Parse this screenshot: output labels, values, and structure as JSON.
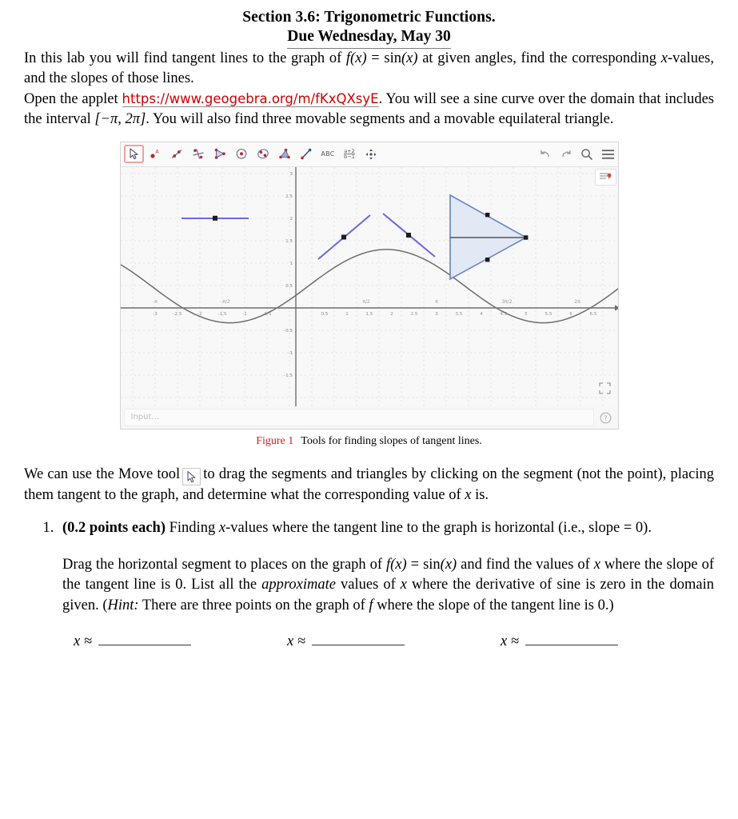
{
  "document": {
    "title_line1": "Section 3.6: Trigonometric Functions.",
    "title_line2": "Due Wednesday, May 30",
    "intro": {
      "part1": "In this lab you will find tangent lines to the graph of ",
      "formula": "f(x) = sin(x)",
      "part2": " at given angles, find the corresponding ",
      "xvar": "x",
      "part3": "-values, and the slopes of those lines."
    },
    "applet_paragraph": {
      "part1": "Open the applet ",
      "url": "https://www.geogebra.org/m/fKxQXsyE",
      "part2": ". You will see a sine curve over the domain that includes the interval ",
      "interval": "[−π, 2π]",
      "part3": ". You will also find three movable segments and a movable equilateral triangle."
    },
    "figure_caption": {
      "number": "Figure 1",
      "text": "Tools for finding slopes of tangent lines."
    },
    "move_paragraph": {
      "part1": "We can use the Move tool",
      "part2": "to drag the segments and triangles by clicking on the segment (not the point), placing them tangent to the graph, and determine what the corresponding value of ",
      "xvar": "x",
      "part3": " is."
    },
    "question1": {
      "number": "1.",
      "points": "(0.2 points each)",
      "prompt_part1": " Finding ",
      "xvar": "x",
      "prompt_part2": "-values where the tangent line to the graph is horizontal (i.e., slope = 0).",
      "subtext_part1": "Drag the horizontal segment to places on the graph of ",
      "formula": "f(x) = sin(x)",
      "subtext_part2": " and find the values of ",
      "subtext_part3": " where the slope of the tangent line is 0. List all the ",
      "emph": "approximate",
      "subtext_part4": " values of ",
      "subtext_part5": " where the derivative of sine is zero in the domain given. (",
      "hint_label": "Hint:",
      "subtext_part6": " There are three points on the graph of ",
      "fvar": "f",
      "subtext_part7": " where the slope of the tangent line is 0.)"
    },
    "answer_blanks": [
      {
        "label": "x ≈"
      },
      {
        "label": "x ≈"
      },
      {
        "label": "x ≈"
      }
    ]
  },
  "applet": {
    "toolbar": [
      {
        "name": "move-tool",
        "icon": "arrow-cursor",
        "selected": true
      },
      {
        "name": "point-tool",
        "icon": "point-a",
        "selected": false
      },
      {
        "name": "line-tool",
        "icon": "line-through-points",
        "selected": false
      },
      {
        "name": "perpendicular-line-tool",
        "icon": "perpendicular-lines",
        "selected": false
      },
      {
        "name": "polygon-tool",
        "icon": "triangle-polygon",
        "selected": false
      },
      {
        "name": "circle-tool",
        "icon": "circle-center-point",
        "selected": false
      },
      {
        "name": "conic-tool",
        "icon": "ellipse",
        "selected": false
      },
      {
        "name": "angle-tool",
        "icon": "angle-measure",
        "selected": false
      },
      {
        "name": "slope-tool",
        "icon": "slope-line",
        "selected": false
      },
      {
        "name": "text-tool",
        "icon": "abc-text",
        "selected": false
      },
      {
        "name": "slider-tool",
        "icon": "fraction-expression",
        "selected": false
      },
      {
        "name": "move-graphics-tool",
        "icon": "four-way-arrows",
        "selected": false
      }
    ],
    "right_tools": [
      {
        "name": "undo-button",
        "icon": "undo-arrow"
      },
      {
        "name": "redo-button",
        "icon": "redo-arrow"
      },
      {
        "name": "search-button",
        "icon": "magnifier-icon"
      },
      {
        "name": "menu-button",
        "icon": "hamburger-icon"
      }
    ],
    "style_button": "style-bar-icon",
    "fullscreen_button": "fullscreen-icon",
    "help_button": "question-mark-icon",
    "input_placeholder": "Input…"
  },
  "chart_data": {
    "type": "line",
    "title": "",
    "xlabel": "",
    "ylabel": "",
    "xlim": [
      -3.25,
      6.8
    ],
    "ylim": [
      -1.75,
      3.05
    ],
    "grid": true,
    "legend": null,
    "series": [
      {
        "name": "f(x) = sin(x)",
        "color": "#666666",
        "type": "function",
        "expression": "sin(x)",
        "domain": [
          -3.25,
          6.8
        ]
      }
    ],
    "x_ticks": [
      -3,
      -2.5,
      -2,
      -1.5,
      -1,
      -0.5,
      0.5,
      1,
      1.5,
      2,
      2.5,
      3,
      3.5,
      4,
      4.5,
      5,
      5.5,
      6,
      6.5
    ],
    "x_tick_labels": [
      "-3",
      "-2.5",
      "-2",
      "-1.5",
      "-1",
      "-0.5",
      "0.5",
      "1",
      "1.5",
      "2",
      "2.5",
      "3",
      "3.5",
      "4",
      "4.5",
      "5",
      "5.5",
      "6",
      "6.5"
    ],
    "x_special_labels": [
      {
        "value": -3.14159,
        "label": "-π"
      },
      {
        "value": -1.5708,
        "label": "-π/2"
      },
      {
        "value": 1.5708,
        "label": "π/2"
      },
      {
        "value": 3.14159,
        "label": "π"
      },
      {
        "value": 4.71239,
        "label": "3π/2"
      },
      {
        "value": 6.28319,
        "label": "2π"
      }
    ],
    "y_ticks": [
      -1.5,
      -1,
      -0.5,
      0.5,
      1,
      1.5,
      2,
      2.5,
      3
    ],
    "y_tick_labels": [
      "-1.5",
      "-1",
      "-0.5",
      "0.5",
      "1",
      "1.5",
      "2",
      "2.5",
      "3"
    ],
    "annotations": [
      {
        "name": "horizontal-segment",
        "kind": "segment",
        "color": "#6a6ae0",
        "x1": -2.55,
        "y1": 2.0,
        "x2": -1.05,
        "y2": 2.0,
        "midpoint": {
          "x": -1.8,
          "y": 2.0
        }
      },
      {
        "name": "rising-segment",
        "kind": "segment",
        "color": "#6a6ae0",
        "x1": 0.5,
        "y1": 1.1,
        "x2": 1.65,
        "y2": 2.1,
        "midpoint": {
          "x": 1.07,
          "y": 1.6
        }
      },
      {
        "name": "falling-segment",
        "kind": "segment",
        "color": "#6a6ae0",
        "x1": 1.95,
        "y1": 2.12,
        "x2": 3.0,
        "y2": 1.15,
        "midpoint": {
          "x": 2.47,
          "y": 1.63
        }
      },
      {
        "name": "equilateral-triangle",
        "kind": "polygon",
        "color": "#6a87c8",
        "fill": "#dce6f5",
        "vertices": [
          {
            "x": 3.45,
            "y": 2.5
          },
          {
            "x": 3.45,
            "y": 0.55
          },
          {
            "x": 5.15,
            "y": 1.53
          }
        ],
        "edge_points": [
          {
            "x": 4.3,
            "y": 2.02
          },
          {
            "x": 4.3,
            "y": 1.04
          }
        ]
      },
      {
        "name": "triangle-base-segment",
        "kind": "segment",
        "color": "#555555",
        "x1": 3.45,
        "y1": 1.53,
        "x2": 5.15,
        "y2": 1.53
      }
    ]
  }
}
